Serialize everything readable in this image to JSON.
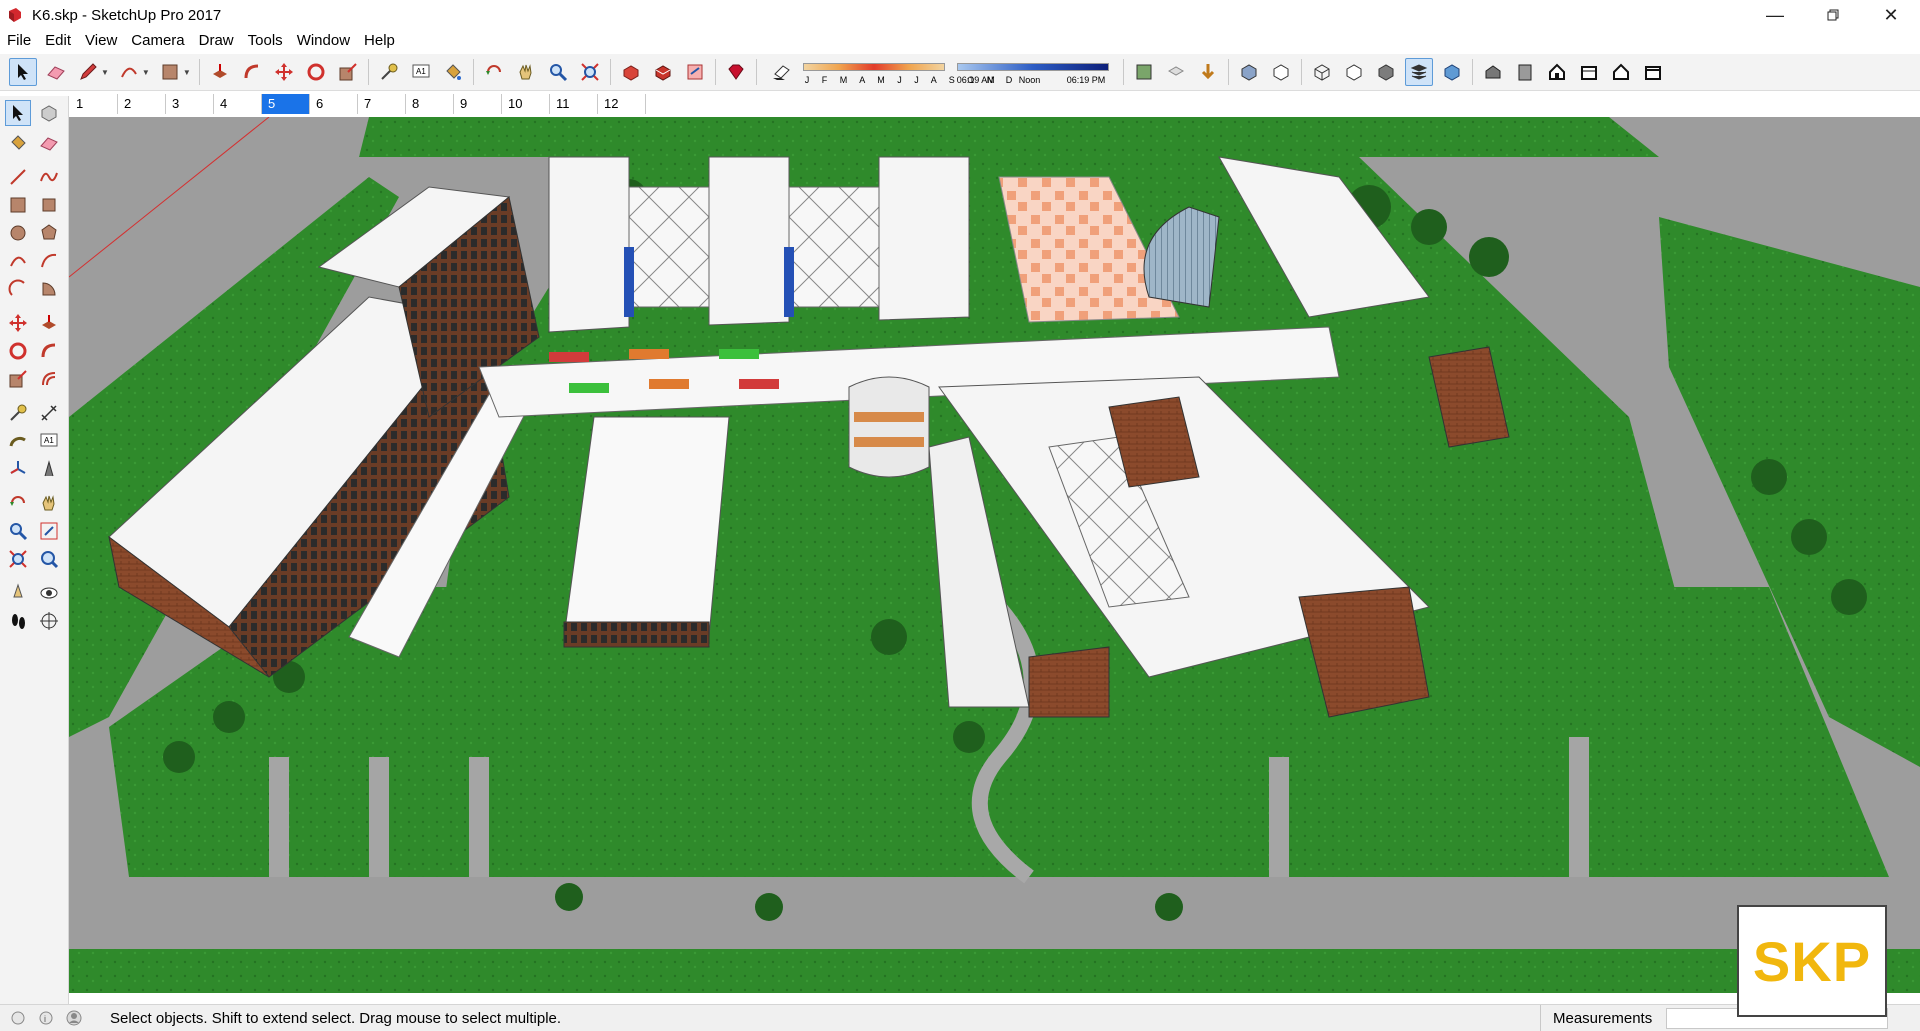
{
  "window": {
    "title": "K6.skp - SketchUp Pro 2017",
    "controls": [
      "minimize-icon",
      "restore-icon",
      "close-icon"
    ]
  },
  "menu": [
    "File",
    "Edit",
    "View",
    "Camera",
    "Draw",
    "Tools",
    "Window",
    "Help"
  ],
  "toolbar": {
    "icons": [
      "select-icon",
      "eraser-icon",
      "pencil-icon",
      "arc-icon",
      "rectangle-icon",
      "push-pull-icon",
      "follow-me-icon",
      "move-icon",
      "rotate-icon",
      "scale-icon",
      "tape-measure-icon",
      "text-icon",
      "paint-bucket-icon",
      "orbit-icon",
      "pan-icon",
      "zoom-icon",
      "zoom-extents-icon",
      "3d-warehouse-icon",
      "extension-warehouse-icon",
      "send-to-layout-icon",
      "ruby-icon"
    ],
    "shadow": {
      "months": "J F M A M J J A S O N D",
      "time_start": "06:19 AM",
      "time_mid": "Noon",
      "time_end": "06:19 PM"
    },
    "style_icons": [
      "xray-icon",
      "back-edges-icon",
      "wireframe-icon",
      "hidden-line-icon",
      "shaded-icon",
      "shaded-textures-icon",
      "monochrome-icon",
      "iso-view-icon",
      "top-view-icon",
      "front-view-icon",
      "right-view-icon",
      "back-view-icon",
      "left-view-icon"
    ]
  },
  "scenes": {
    "tabs": [
      "1",
      "2",
      "3",
      "4",
      "5",
      "6",
      "7",
      "8",
      "9",
      "10",
      "11",
      "12"
    ],
    "selected": "5"
  },
  "status": {
    "text": "Select objects. Shift to extend select. Drag mouse to select multiple.",
    "measurements_label": "Measurements",
    "measurements_value": ""
  },
  "watermark": "SKP",
  "colors": {
    "grass": "#2f8a2b",
    "road": "#9d9d9d",
    "brick": "#8b4a2c",
    "roof": "#f7f7f7",
    "selected_tab": "#1a73e8",
    "logo": "#f1b70e"
  }
}
